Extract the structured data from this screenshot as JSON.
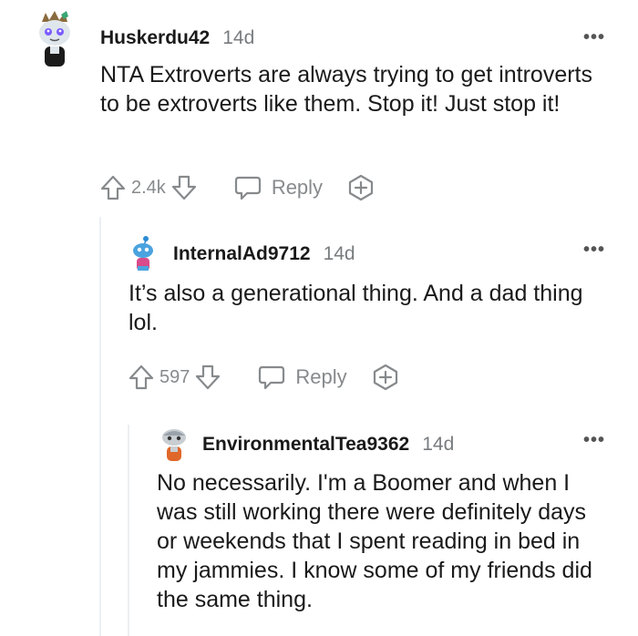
{
  "comments": [
    {
      "username": "Huskerdu42",
      "time": "14d",
      "text": "NTA Extroverts are always trying to get introverts to be extroverts like them. Stop it! Just stop it!",
      "votes": "2.4k",
      "reply_label": "Reply"
    },
    {
      "username": "InternalAd9712",
      "time": "14d",
      "text": "It’s also a generational thing. And a dad thing lol.",
      "votes": "597",
      "reply_label": "Reply"
    },
    {
      "username": "EnvironmentalTea9362",
      "time": "14d",
      "text": "No necessarily. I'm a Boomer and when I was still working there were definitely days or weekends that I spent reading in bed in my jammies. I know some of my friends did the same thing."
    }
  ],
  "more_label": "•••",
  "colors": {
    "text": "#1a1a1b",
    "meta": "#787c7e",
    "icon": "#878a8c",
    "thread_line": "#edeff1"
  },
  "icons": [
    "snoo-avatar-icon",
    "upvote-icon",
    "downvote-icon",
    "reply-bubble-icon",
    "award-plus-icon",
    "more-dots-icon"
  ]
}
